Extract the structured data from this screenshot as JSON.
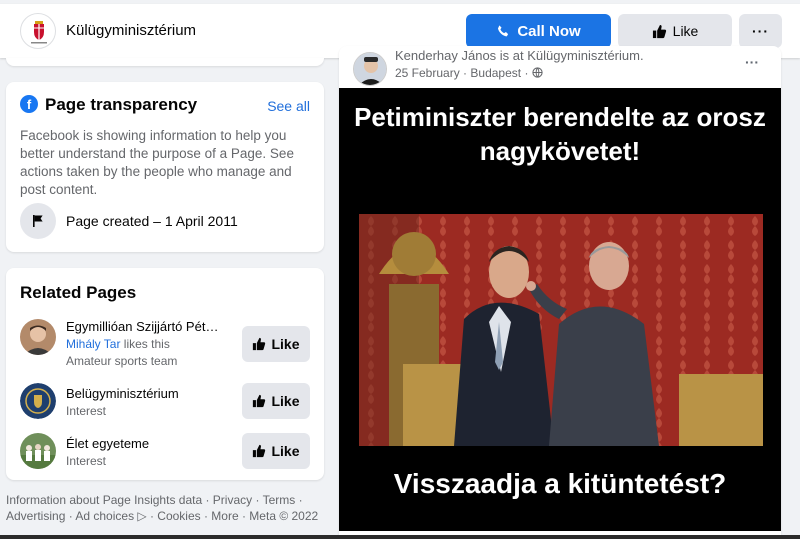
{
  "header": {
    "page_name": "Külügyminisztérium",
    "call_now": "Call Now",
    "like": "Like",
    "more": "···"
  },
  "transparency": {
    "title": "Page transparency",
    "see_all": "See all",
    "description": "Facebook is showing information to help you better understand the purpose of a Page. See actions taken by the people who manage and post content.",
    "page_created": "Page created – 1 April 2011"
  },
  "related": {
    "title": "Related Pages",
    "items": [
      {
        "name": "Egymillióan Szijjártó Pét…",
        "liker": "Mihály Tar",
        "liker_suffix": " likes this",
        "category": "Amateur sports team",
        "like": "Like"
      },
      {
        "name": "Belügyminisztérium",
        "category": "Interest",
        "like": "Like"
      },
      {
        "name": "Élet egyeteme",
        "category": "Interest",
        "like": "Like"
      }
    ]
  },
  "footer": {
    "text": "Information about Page Insights data · Privacy · Terms · Advertising · Ad choices ▷ · Cookies · More · Meta © 2022"
  },
  "post": {
    "author": "Kenderhay János is at Külügyminisztérium.",
    "date": "25 February",
    "location": "Budapest",
    "more": "···",
    "image_headline": "Petiminiszter berendelte az orosz nagykövetet!",
    "image_bottom": "Visszaadja a kitüntetést?"
  },
  "colors": {
    "accent": "#1b74e4",
    "link": "#216fdb",
    "background": "#f0f2f5"
  }
}
